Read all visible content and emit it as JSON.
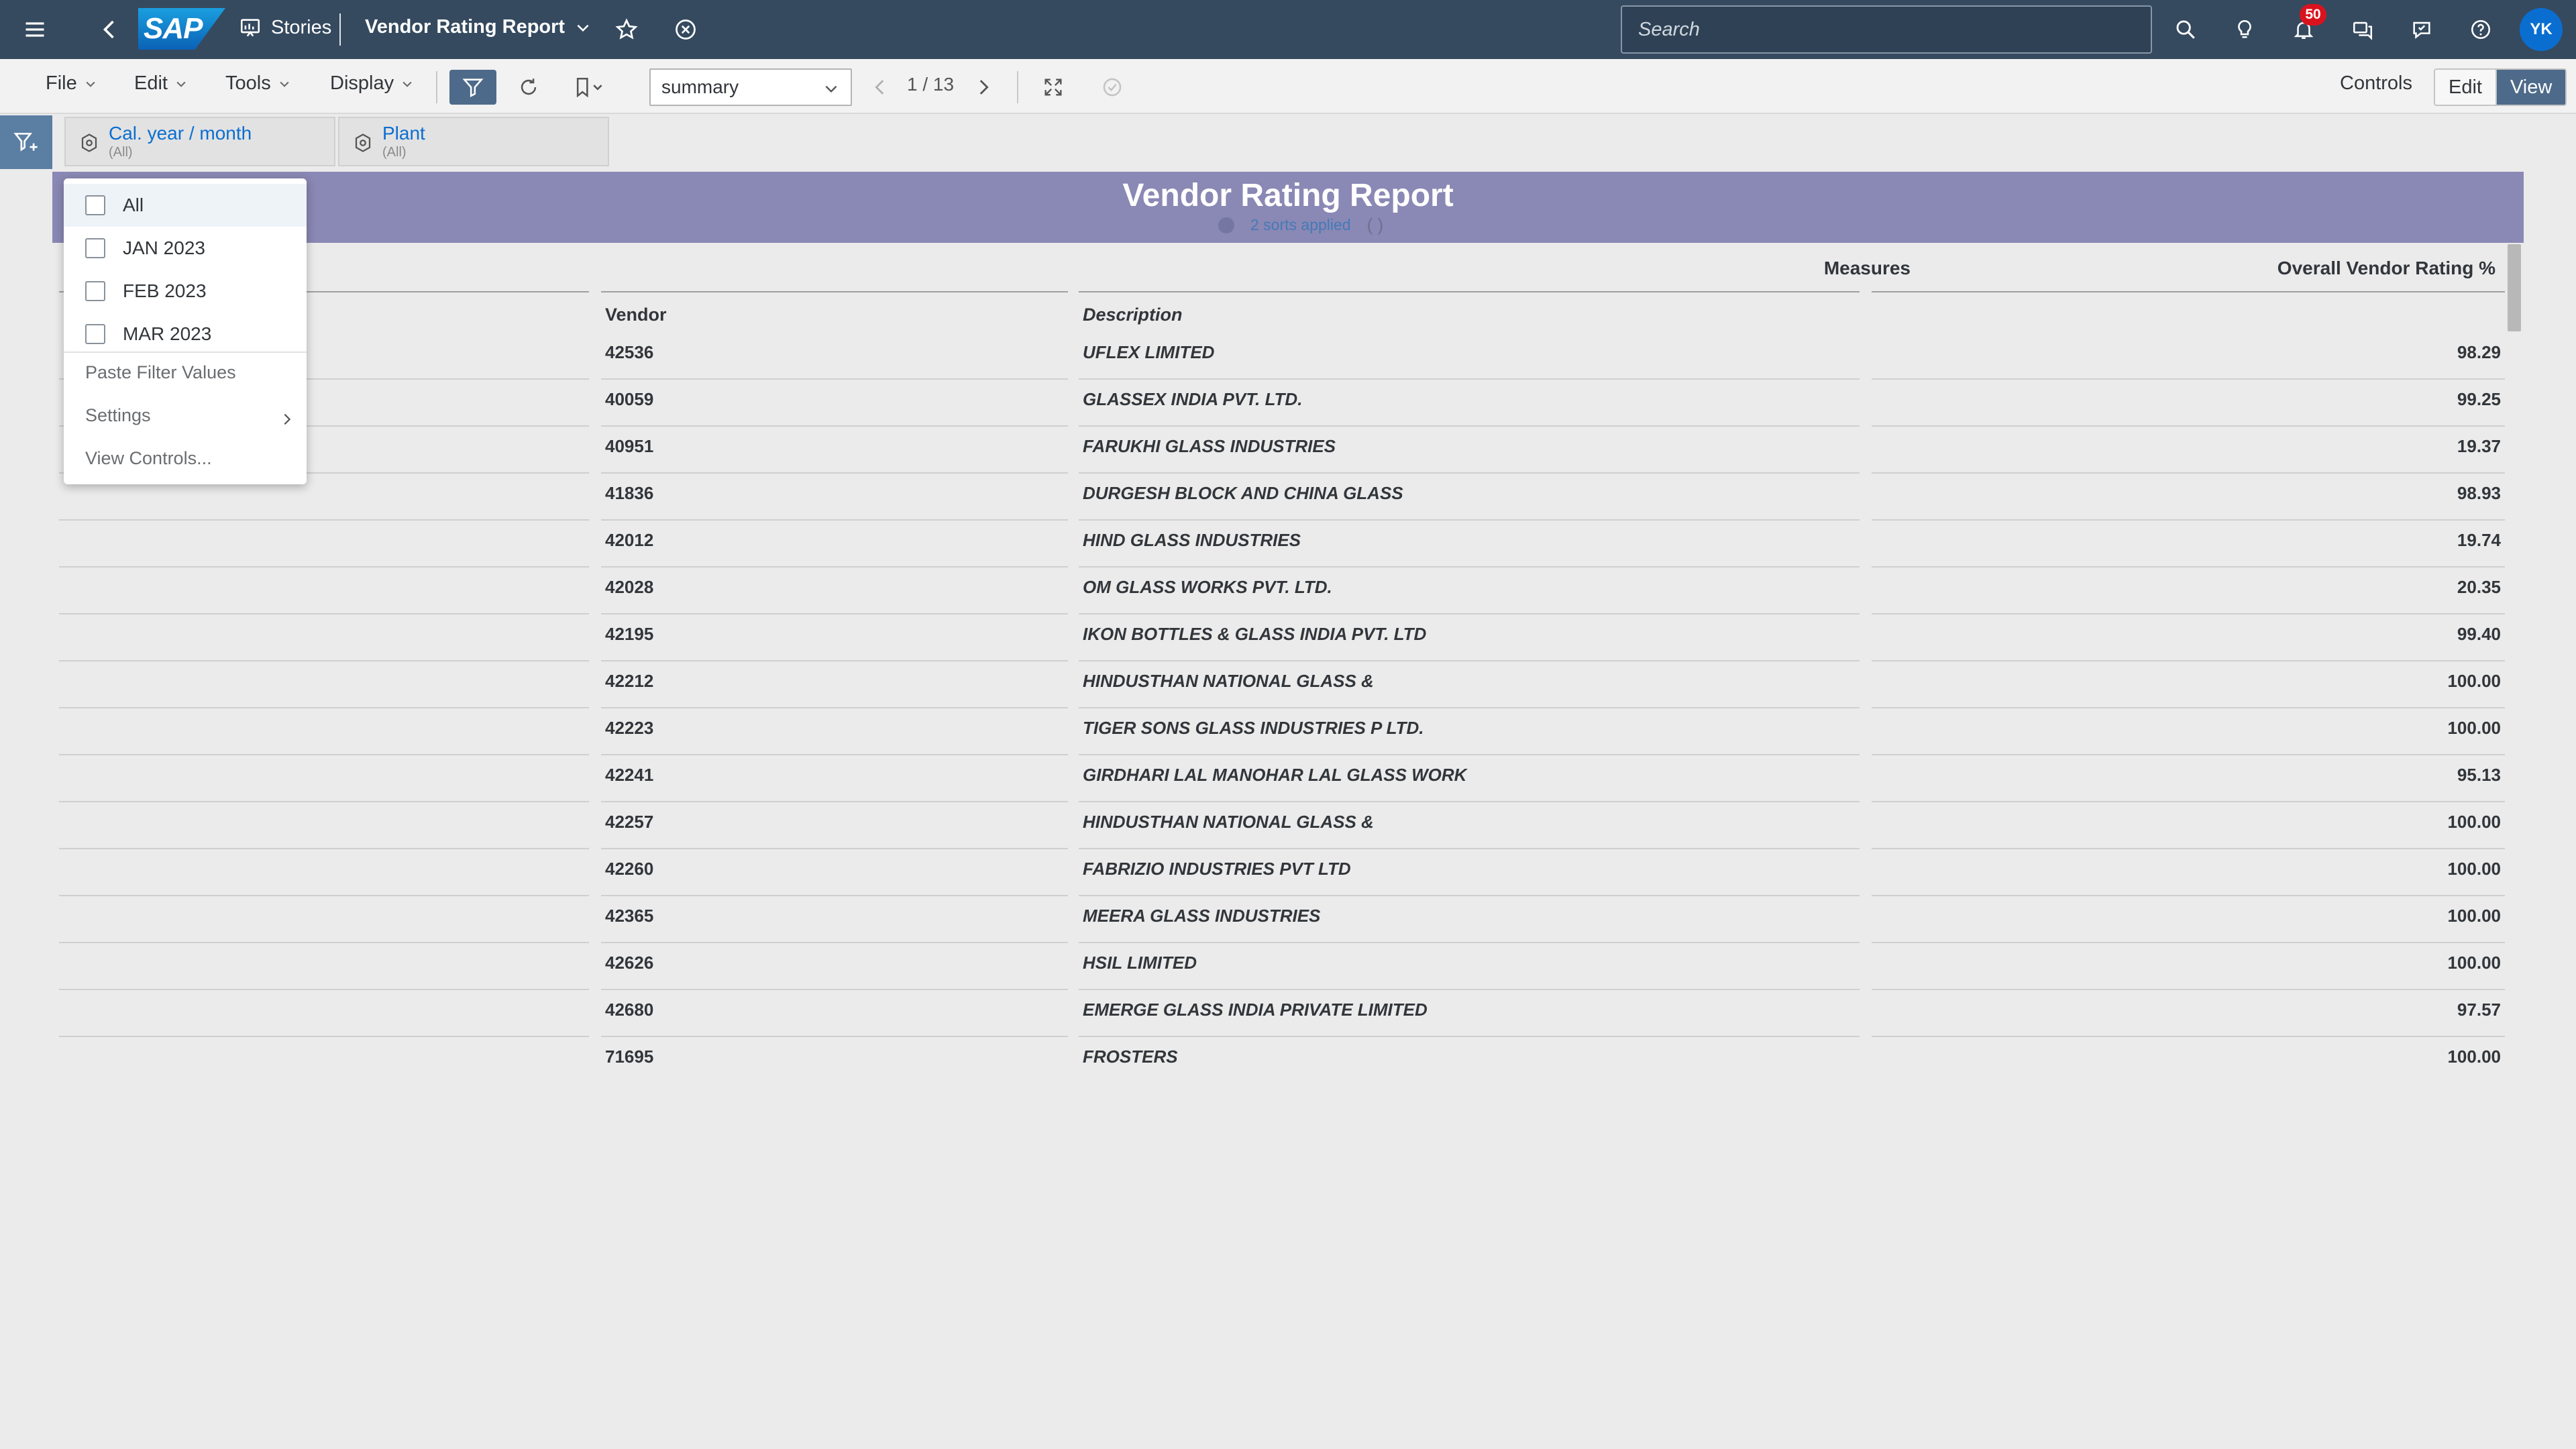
{
  "shell": {
    "stories_label": "Stories",
    "title": "Vendor Rating Report",
    "search_placeholder": "Search",
    "notification_count": "50",
    "avatar_initials": "YK"
  },
  "toolbar": {
    "menus": [
      "File",
      "Edit",
      "Tools",
      "Display"
    ],
    "page_select_value": "summary",
    "page_indicator": "1 / 13",
    "controls_label": "Controls",
    "edit_label": "Edit",
    "view_label": "View"
  },
  "filters": [
    {
      "name": "Cal. year / month",
      "value": "(All)"
    },
    {
      "name": "Plant",
      "value": "(All)"
    }
  ],
  "dropdown": {
    "options": [
      "All",
      "JAN 2023",
      "FEB 2023",
      "MAR 2023"
    ],
    "actions": [
      "Paste Filter Values",
      "Settings",
      "View Controls..."
    ]
  },
  "report": {
    "title": "Vendor Rating Report",
    "sorts_text": "2 sorts applied",
    "sorts_paren": "( )",
    "measures_header": "Measures",
    "rating_header": "Overall Vendor Rating %",
    "vendor_header": "Vendor",
    "description_header": "Description",
    "rows": [
      {
        "vendor": "42536",
        "description": "UFLEX LIMITED",
        "rating": "98.29"
      },
      {
        "vendor": "40059",
        "description": "GLASSEX INDIA PVT. LTD.",
        "rating": "99.25"
      },
      {
        "vendor": "40951",
        "description": "FARUKHI GLASS INDUSTRIES",
        "rating": "19.37"
      },
      {
        "vendor": "41836",
        "description": "DURGESH BLOCK AND CHINA GLASS",
        "rating": "98.93"
      },
      {
        "vendor": "42012",
        "description": "HIND GLASS INDUSTRIES",
        "rating": "19.74"
      },
      {
        "vendor": "42028",
        "description": "OM GLASS WORKS PVT. LTD.",
        "rating": "20.35"
      },
      {
        "vendor": "42195",
        "description": "IKON BOTTLES & GLASS INDIA PVT. LTD",
        "rating": "99.40"
      },
      {
        "vendor": "42212",
        "description": "HINDUSTHAN NATIONAL GLASS &",
        "rating": "100.00"
      },
      {
        "vendor": "42223",
        "description": "TIGER SONS GLASS INDUSTRIES P LTD.",
        "rating": "100.00"
      },
      {
        "vendor": "42241",
        "description": "GIRDHARI LAL MANOHAR LAL GLASS WORK",
        "rating": "95.13"
      },
      {
        "vendor": "42257",
        "description": "HINDUSTHAN NATIONAL GLASS &",
        "rating": "100.00"
      },
      {
        "vendor": "42260",
        "description": "FABRIZIO INDUSTRIES PVT LTD",
        "rating": "100.00"
      },
      {
        "vendor": "42365",
        "description": "MEERA GLASS INDUSTRIES",
        "rating": "100.00"
      },
      {
        "vendor": "42626",
        "description": "HSIL LIMITED",
        "rating": "100.00"
      },
      {
        "vendor": "42680",
        "description": "EMERGE GLASS INDIA PRIVATE LIMITED",
        "rating": "97.57"
      },
      {
        "vendor": "71695",
        "description": "FROSTERS",
        "rating": "100.00"
      }
    ]
  },
  "icons": {
    "hamburger": "menu-icon",
    "back": "back-icon",
    "stories": "stories-icon",
    "favorite": "star-icon",
    "close": "close-circle-icon",
    "search": "search-icon",
    "ideas": "lightbulb-icon",
    "notifications": "bell-icon",
    "chat": "chat-icon",
    "feedback": "feedback-icon",
    "help": "help-icon"
  },
  "colors": {
    "shell_bg": "#354a5f",
    "header_band": "#8a88b4",
    "accent": "#0a6ed1",
    "active_button": "#4d6a8a",
    "badge": "#d9131e"
  }
}
